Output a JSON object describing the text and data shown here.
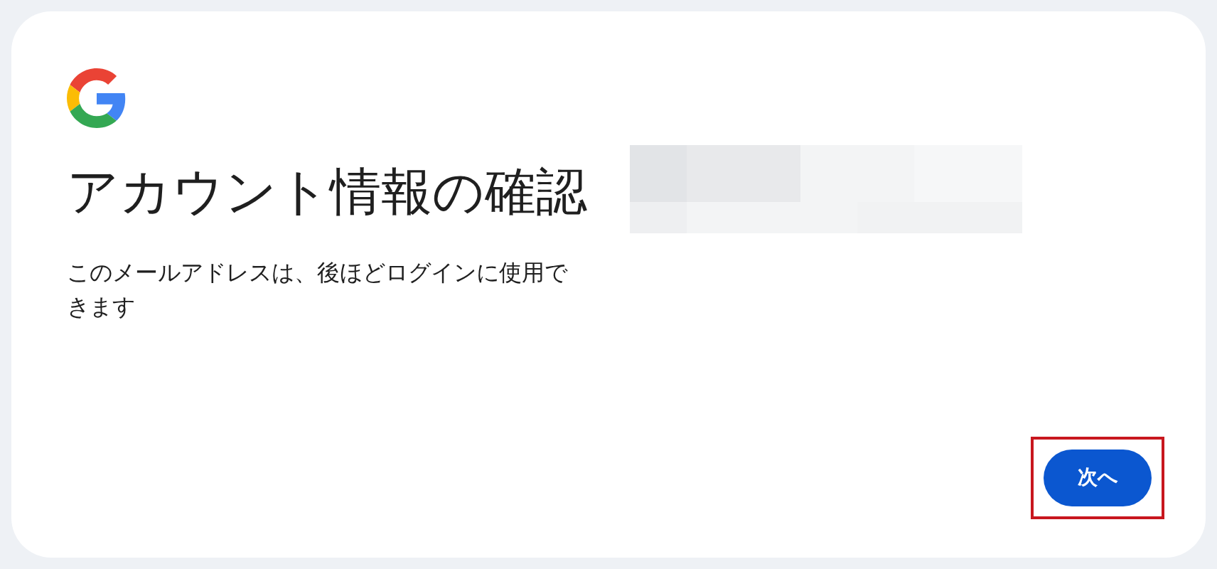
{
  "title": "アカウント情報の確認",
  "description": "このメールアドレスは、後ほどログインに使用できます",
  "next_button": "次へ"
}
